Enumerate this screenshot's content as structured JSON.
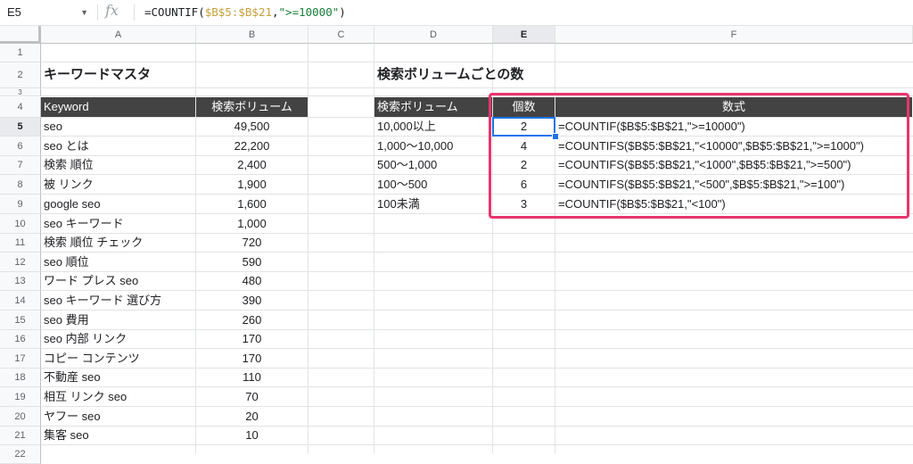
{
  "formula_bar": {
    "cell_ref": "E5",
    "fx": "fx",
    "formula_prefix": "=COUNTIF(",
    "formula_ref": "$B$5:$B$21",
    "formula_comma": ",",
    "formula_str": "\">=10000\"",
    "formula_suffix": ")"
  },
  "columns": [
    "A",
    "B",
    "C",
    "D",
    "E",
    "F"
  ],
  "rows": [
    "1",
    "2",
    "3",
    "4",
    "5",
    "6",
    "7",
    "8",
    "9",
    "10",
    "11",
    "12",
    "13",
    "14",
    "15",
    "16",
    "17",
    "18",
    "19",
    "20",
    "21",
    "22"
  ],
  "left_table": {
    "title": "キーワードマスタ",
    "header_keyword": "Keyword",
    "header_volume": "検索ボリューム",
    "rows": [
      {
        "keyword": "seo",
        "volume": "49,500"
      },
      {
        "keyword": "seo とは",
        "volume": "22,200"
      },
      {
        "keyword": "検索 順位",
        "volume": "2,400"
      },
      {
        "keyword": "被 リンク",
        "volume": "1,900"
      },
      {
        "keyword": "google seo",
        "volume": "1,600"
      },
      {
        "keyword": "seo キーワード",
        "volume": "1,000"
      },
      {
        "keyword": "検索 順位 チェック",
        "volume": "720"
      },
      {
        "keyword": "seo 順位",
        "volume": "590"
      },
      {
        "keyword": "ワード プレス seo",
        "volume": "480"
      },
      {
        "keyword": "seo キーワード 選び方",
        "volume": "390"
      },
      {
        "keyword": "seo 費用",
        "volume": "260"
      },
      {
        "keyword": "seo 内部 リンク",
        "volume": "170"
      },
      {
        "keyword": "コピー コンテンツ",
        "volume": "170"
      },
      {
        "keyword": "不動産 seo",
        "volume": "110"
      },
      {
        "keyword": "相互 リンク seo",
        "volume": "70"
      },
      {
        "keyword": "ヤフー seo",
        "volume": "20"
      },
      {
        "keyword": "集客 seo",
        "volume": "10"
      }
    ]
  },
  "right_table": {
    "title": "検索ボリュームごとの数",
    "header_range": "検索ボリューム",
    "header_count": "個数",
    "header_formula": "数式",
    "rows": [
      {
        "range": "10,000以上",
        "count": "2",
        "formula": "=COUNTIF($B$5:$B$21,\">=10000\")"
      },
      {
        "range": "1,000〜10,000",
        "count": "4",
        "formula": "=COUNTIFS($B$5:$B$21,\"<10000\",$B$5:$B$21,\">=1000\")"
      },
      {
        "range": "500〜1,000",
        "count": "2",
        "formula": "=COUNTIFS($B$5:$B$21,\"<1000\",$B$5:$B$21,\">=500\")"
      },
      {
        "range": "100〜500",
        "count": "6",
        "formula": "=COUNTIFS($B$5:$B$21,\"<500\",$B$5:$B$21,\">=100\")"
      },
      {
        "range": "100未満",
        "count": "3",
        "formula": "=COUNTIF($B$5:$B$21,\"<100\")"
      }
    ]
  },
  "colors": {
    "header_bg": "#434343",
    "highlight_border": "#e8356e",
    "selection": "#1a73e8"
  }
}
